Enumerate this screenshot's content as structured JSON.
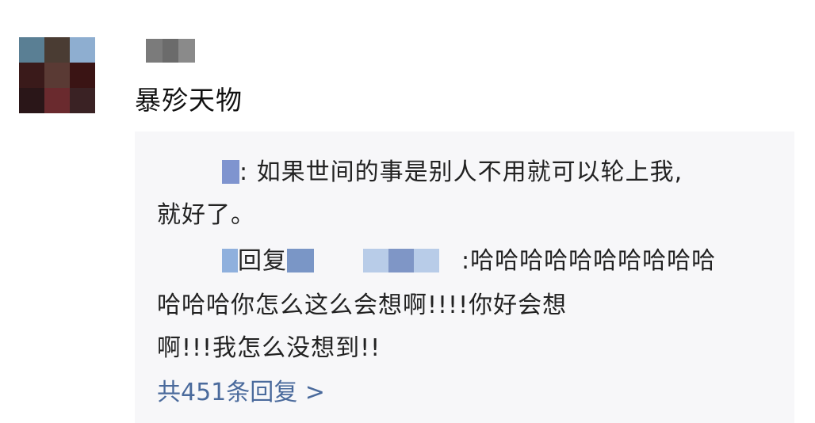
{
  "post": {
    "text": "暴殄天物"
  },
  "replies": [
    {
      "body_line1": "如果世间的事是别人不用就可以轮上我,",
      "body_line2": "就好了。"
    },
    {
      "reply_word": "回复",
      "body_line1": "哈哈哈哈哈哈哈哈哈哈",
      "body_line2": "哈哈哈你怎么这么会想啊!!!!你好会想",
      "body_line3": "啊!!!我怎么没想到!!"
    }
  ],
  "more_replies": "共451条回复 >",
  "colors": {
    "link": "#4a6a9c",
    "reply_bg": "#f7f7f9"
  }
}
